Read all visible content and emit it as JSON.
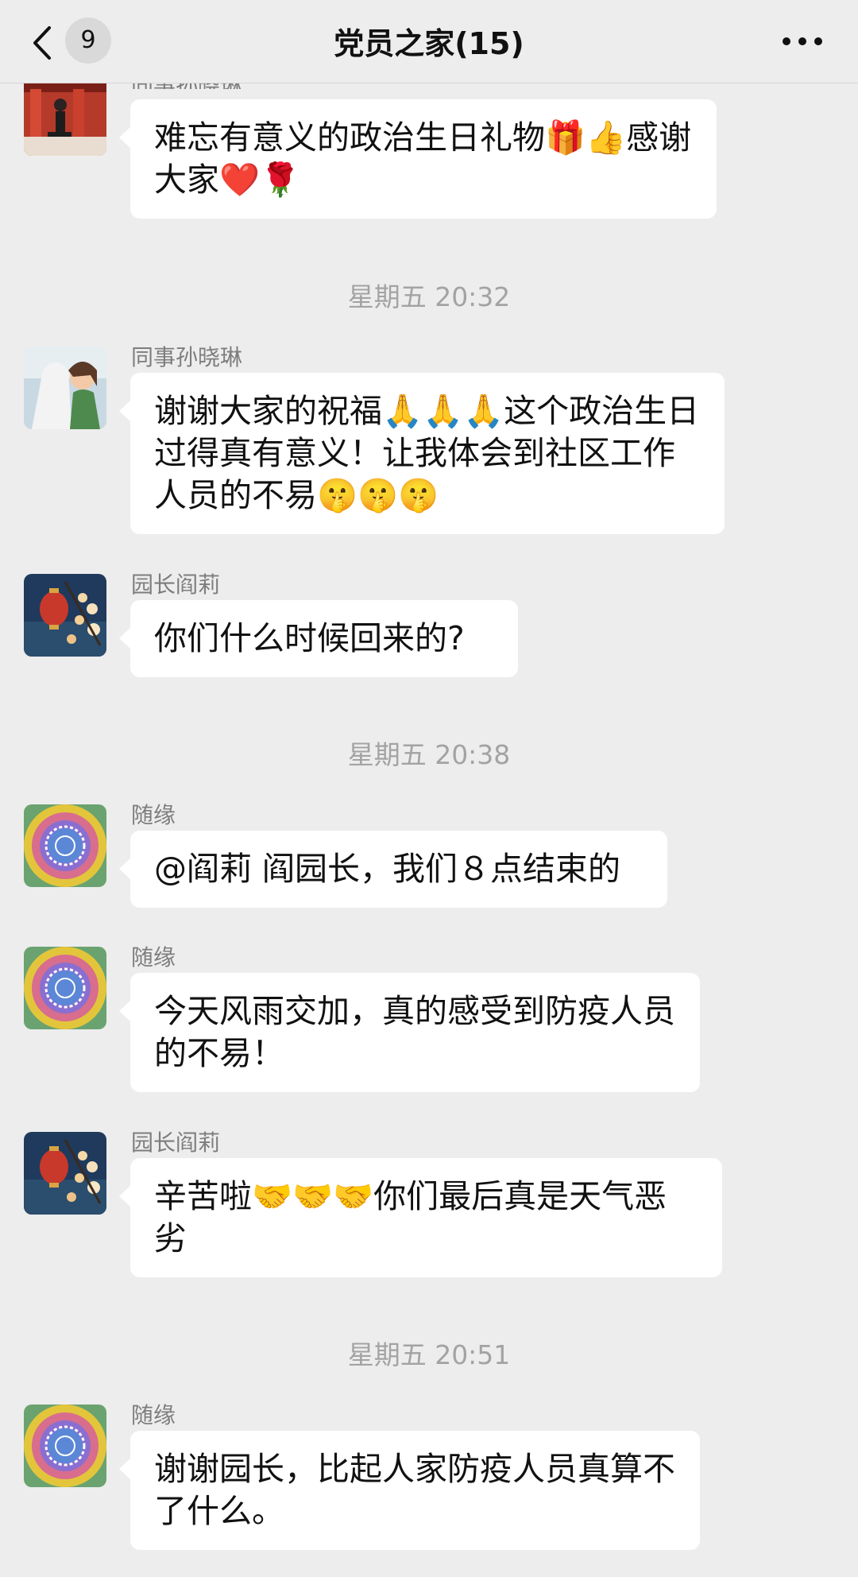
{
  "header": {
    "back_count": "9",
    "title": "党员之家(15)",
    "back_icon": "chevron-left-icon",
    "more_icon": "more-dots-icon"
  },
  "messages": [
    {
      "sender": "同事孙晓琳",
      "text": "难忘有意义的政治生日礼物🎁👍感谢大家❤️🌹"
    },
    {
      "time": "星期五 20:32"
    },
    {
      "sender": "同事孙晓琳",
      "text": "谢谢大家的祝福🙏🙏🙏这个政治生日过得真有意义！让我体会到社区工作人员的不易🤫🤫🤫"
    },
    {
      "sender": "园长阎莉",
      "text": "你们什么时候回来的?"
    },
    {
      "time": "星期五 20:38"
    },
    {
      "sender": "随缘",
      "text": "@阎莉 阎园长，我们８点结束的"
    },
    {
      "sender": "随缘",
      "text": "今天风雨交加，真的感受到防疫人员的不易！"
    },
    {
      "sender": "园长阎莉",
      "text": "辛苦啦🤝🤝🤝你们最后真是天气恶劣"
    },
    {
      "time": "星期五 20:51"
    },
    {
      "sender": "随缘",
      "text": "谢谢园长，比起人家防疫人员真算不了什么。"
    }
  ]
}
